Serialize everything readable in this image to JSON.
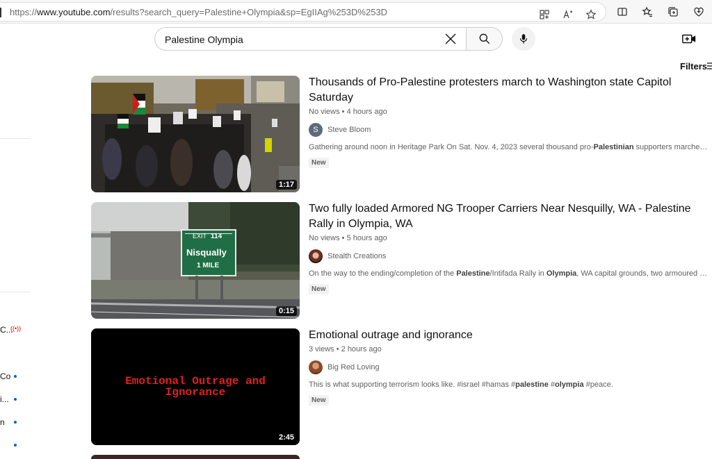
{
  "browser": {
    "url_prefix": "https://",
    "url_host": "www.youtube.com",
    "url_path": "/results?search_query=Palestine+Olympia&sp=EgIIAg%253D%253D",
    "icons": [
      "apps-icon",
      "read-aloud-icon",
      "favorite-star-icon",
      "split-screen-icon",
      "favorites-icon",
      "collections-icon",
      "extensions-heart-icon"
    ]
  },
  "search": {
    "query": "Palestine Olympia"
  },
  "filters_label": "Filters",
  "sidebar": {
    "items": [
      "C...",
      "Co",
      "i...",
      "n"
    ]
  },
  "results": [
    {
      "title": "Thousands of Pro-Palestine protesters march to Washington state Capitol Saturday",
      "meta": "No views • 4 hours ago",
      "channel": "Steve Bloom",
      "avatar_letter": "S",
      "desc_pre": "Gathering around noon in Heritage Park On Sat. Nov. 4, 2023 several thousand pro-",
      "desc_b1": "Palestinian",
      "desc_post": " supporters marched up Capitol ...",
      "badge": "New",
      "duration": "1:17"
    },
    {
      "title": "Two fully loaded Armored NG Trooper Carriers Near Nesquilly, WA - Palestine Rally in Olympia, WA",
      "meta": "No views • 5 hours ago",
      "channel": "Stealth Creations",
      "desc_pre": "On the way to the ending/completion of the ",
      "desc_b1": "Palestine",
      "desc_mid": "/Intifada Rally in ",
      "desc_b2": "Olympia",
      "desc_post": ", WA capital grounds, two armoured carriers were ...",
      "badge": "New",
      "duration": "0:15",
      "sign_exit": "EXIT",
      "sign_num": "114",
      "sign_name": "Nisqually",
      "sign_dist": "1 MILE"
    },
    {
      "title": "Emotional outrage and ignorance",
      "meta": "3 views • 2 hours ago",
      "channel": "Big Red Loving",
      "desc_pre": "This is what supporting terrorism looks like. #israel #hamas #",
      "desc_b1": "palestine",
      "desc_mid": " #",
      "desc_b2": "olympia",
      "desc_post": " #peace.",
      "badge": "New",
      "duration": "2:45",
      "thumb_text_1": "Emotional Outrage and",
      "thumb_text_2": "Ignorance"
    }
  ]
}
